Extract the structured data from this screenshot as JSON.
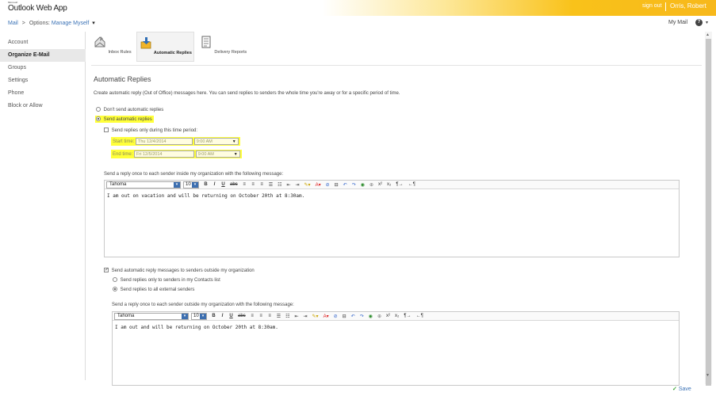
{
  "app": {
    "brand_ms": "Microsoft",
    "brand_name": "Outlook Web App",
    "sign_out": "sign out",
    "user": "Orris, Robert"
  },
  "nav": {
    "mail": "Mail",
    "sep": ">",
    "options": "Options:",
    "manage": "Manage Myself",
    "my_mail": "My Mail",
    "help": "?"
  },
  "sidebar": {
    "items": [
      {
        "label": "Account"
      },
      {
        "label": "Organize E-Mail"
      },
      {
        "label": "Groups"
      },
      {
        "label": "Settings"
      },
      {
        "label": "Phone"
      },
      {
        "label": "Block or Allow"
      }
    ]
  },
  "tabs": [
    {
      "label": "Inbox Rules",
      "icon": "inbox-rules-icon"
    },
    {
      "label": "Automatic Replies",
      "icon": "automatic-replies-icon"
    },
    {
      "label": "Delivery Reports",
      "icon": "delivery-reports-icon"
    }
  ],
  "main": {
    "title": "Automatic Replies",
    "description": "Create automatic reply (Out of Office) messages here. You can send replies to senders the whole time you're away or for a specific period of time.",
    "dont_send": "Don't send automatic replies",
    "send": "Send automatic replies",
    "period": "Send replies only during this time period:",
    "start_label": "Start time:",
    "start_date": "Thu 12/4/2014",
    "start_time": "9:00 AM",
    "end_label": "End time:",
    "end_date": "Fri 12/5/2014",
    "end_time": "9:00 AM",
    "inside_label": "Send a reply once to each sender inside my organization with the following message:",
    "inside_msg": "I am out on vacation and will be returning on October 20th at 8:30am.",
    "outside_check": "Send automatic reply messages to senders outside my organization",
    "contacts_only": "Send replies only to senders in my Contacts list",
    "all_external": "Send replies to all external senders",
    "outside_label": "Send a reply once to each sender outside my organization with the following message:",
    "outside_msg": "I am out and will be returning on October 20th at 8:30am."
  },
  "editor": {
    "font": "Tahoma",
    "size": "10"
  },
  "save": "Save",
  "colors": {
    "accent": "#f9c21a",
    "link": "#3c73b6",
    "highlight": "#ffff3a"
  }
}
